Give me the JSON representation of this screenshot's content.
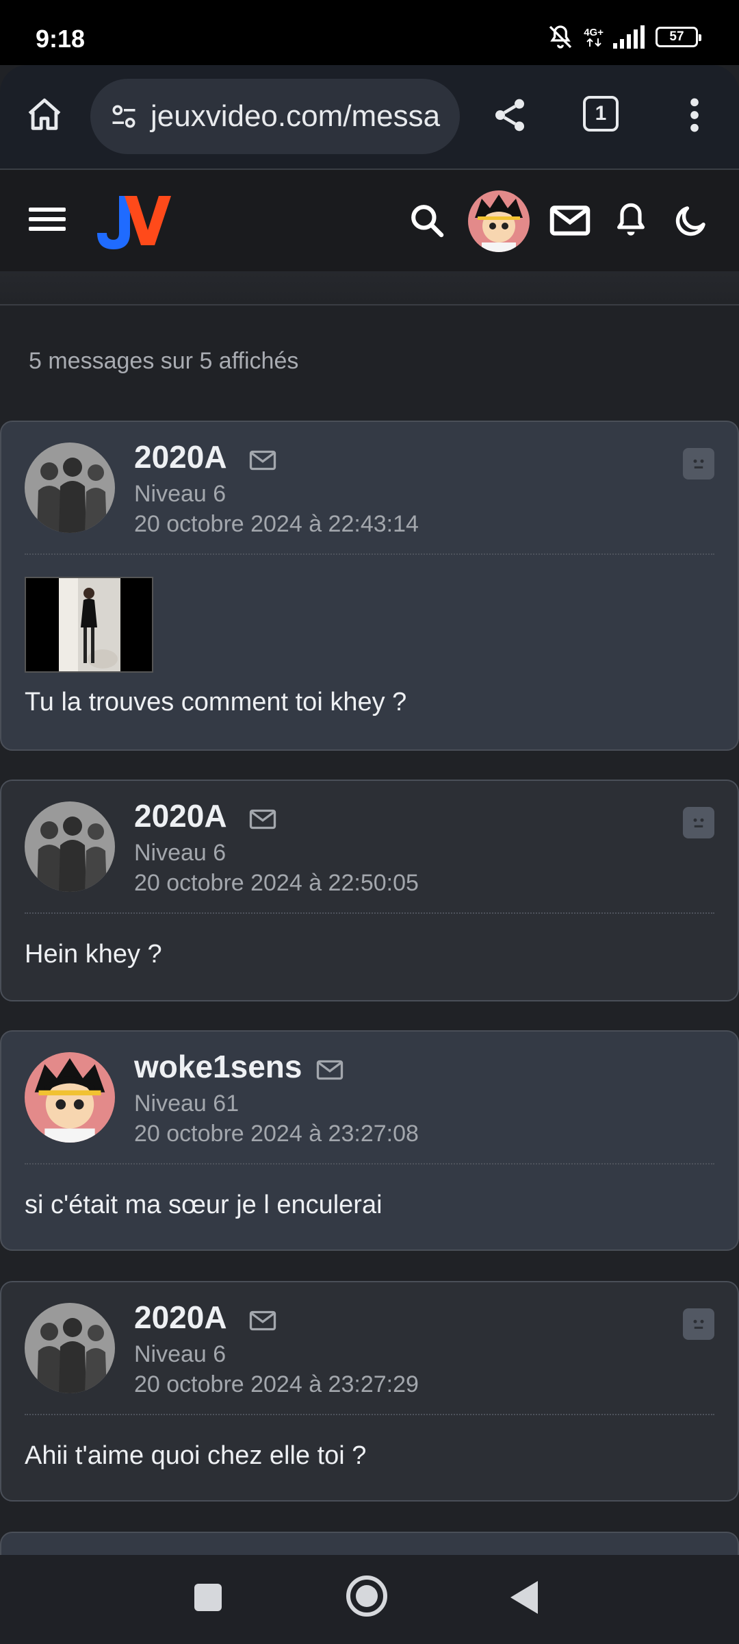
{
  "status_bar": {
    "time": "9:18",
    "network": "4G+",
    "battery": "57"
  },
  "browser": {
    "url": "jeuxvideo.com/messa",
    "tab_count": "1"
  },
  "header": {
    "logo_text": "JV"
  },
  "topic": {
    "message_count": "5 messages sur 5 affichés"
  },
  "posts": [
    {
      "pseudo": "2020A",
      "level": "Niveau 6",
      "date": "20 octobre 2024 à 22:43:14",
      "text": "Tu la trouves comment toi khey ?",
      "has_image": true
    },
    {
      "pseudo": "2020A",
      "level": "Niveau 6",
      "date": "20 octobre 2024 à 22:50:05",
      "text": "Hein khey ?"
    },
    {
      "pseudo": "woke1sens",
      "level": "Niveau 61",
      "date": "20 octobre 2024 à 23:27:08",
      "text": "si c'était ma sœur je l enculerai"
    },
    {
      "pseudo": "2020A",
      "level": "Niveau 6",
      "date": "20 octobre 2024 à 23:27:29",
      "text": "Ahii t'aime quoi chez elle toi ?"
    }
  ],
  "icons": {
    "home": "home-icon",
    "tune": "site-settings-icon",
    "share": "share-icon",
    "menu": "more-vert-icon",
    "search": "search-icon",
    "mail": "mail-icon",
    "bell": "bell-icon",
    "moon": "dark-mode-icon",
    "report": "report-icon"
  },
  "colors": {
    "logo_orange": "#ff4a1a",
    "logo_blue": "#1f6bff",
    "card_light": "#343a45",
    "card_dark": "#2c2f35"
  }
}
